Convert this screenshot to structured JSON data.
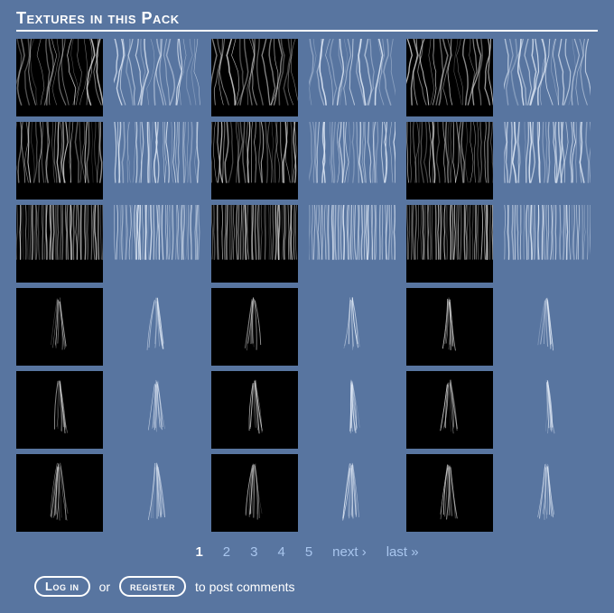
{
  "section": {
    "title": "Textures in this Pack"
  },
  "grid": {
    "rows": 6,
    "cols": 6,
    "evenColBg": "black",
    "oddColBg": "transparent",
    "evenColStroke": "#dcdcdc",
    "oddColStroke": "#e8f0fb",
    "rowStyles": [
      {
        "kind": "wave",
        "fillRatio": 0.85,
        "lines": 20
      },
      {
        "kind": "jitter",
        "fillRatio": 0.78,
        "lines": 28
      },
      {
        "kind": "dense",
        "fillRatio": 0.7,
        "lines": 40
      },
      {
        "kind": "wisp",
        "fillRatio": 0.85,
        "lines": 10
      },
      {
        "kind": "wisp",
        "fillRatio": 0.85,
        "lines": 11
      },
      {
        "kind": "wisp",
        "fillRatio": 0.9,
        "lines": 12
      }
    ]
  },
  "pager": {
    "pages": [
      "1",
      "2",
      "3",
      "4",
      "5"
    ],
    "current": "1",
    "next": "next ›",
    "last": "last »"
  },
  "comments": {
    "login": "Log in",
    "or": "or",
    "register": "register",
    "toPost": "to post comments"
  }
}
